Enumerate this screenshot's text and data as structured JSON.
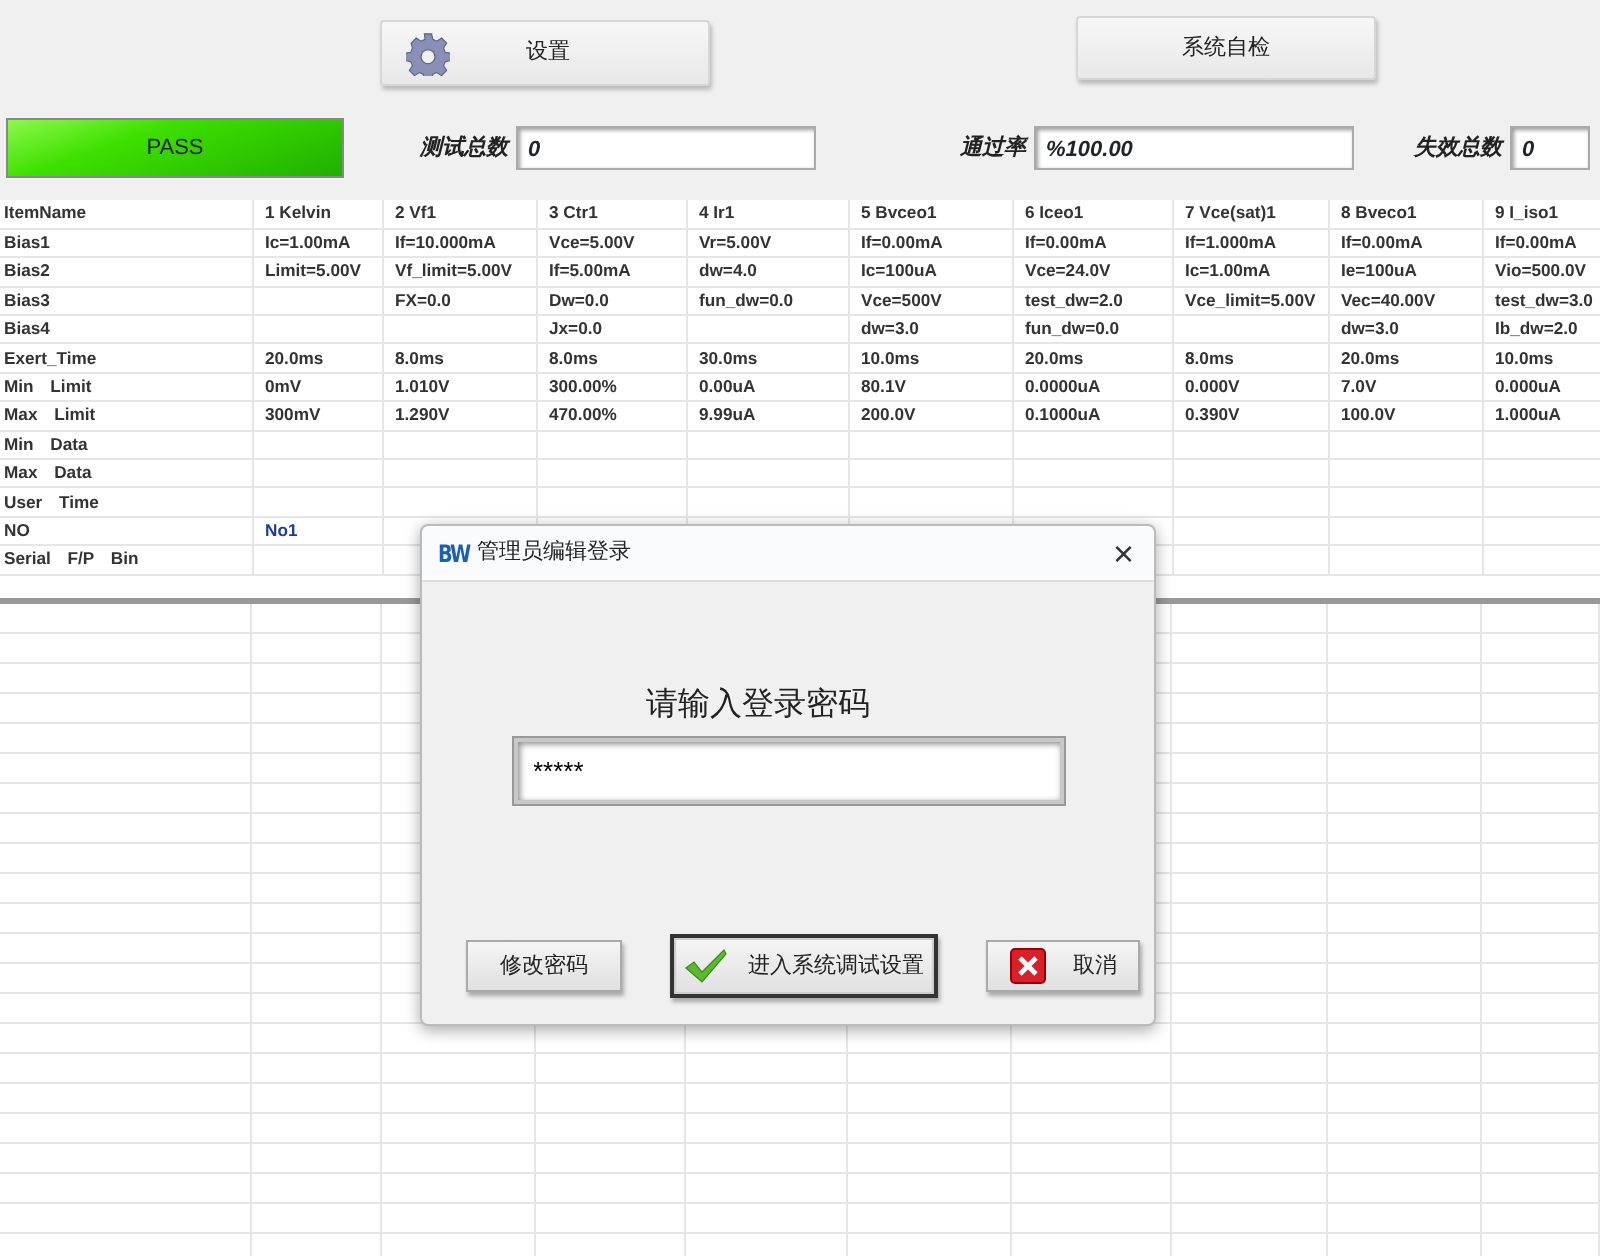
{
  "toolbar": {
    "buttons": [
      {
        "label": "设置",
        "kind": "gear"
      },
      {
        "label": "系统自检",
        "kind": "plain"
      }
    ]
  },
  "status": {
    "result": "PASS",
    "kind": "pass"
  },
  "counters": [
    {
      "label": "测试总数",
      "value": "0"
    },
    {
      "label": "通过率",
      "value": "%100.00"
    },
    {
      "label": "失效总数",
      "value": "0"
    }
  ],
  "table": {
    "corner": "ItemName",
    "columns": [
      "1 Kelvin",
      "2 Vf1",
      "3 Ctr1",
      "4 Ir1",
      "5 Bvceo1",
      "6 Iceo1",
      "7 Vce(sat)1",
      "8 Bveco1",
      "9 I_iso1"
    ],
    "rows": [
      {
        "label": "Bias1",
        "kind": "data",
        "cells": [
          "Ic=1.00mA",
          "If=10.000mA",
          "Vce=5.00V",
          "Vr=5.00V",
          "If=0.00mA",
          "If=0.00mA",
          "If=1.000mA",
          "If=0.00mA",
          "If=0.00mA"
        ]
      },
      {
        "label": "Bias2",
        "kind": "data",
        "cells": [
          "Limit=5.00V",
          "Vf_limit=5.00V",
          "If=5.00mA",
          "dw=4.0",
          "Ic=100uA",
          "Vce=24.0V",
          "Ic=1.00mA",
          "Ie=100uA",
          "Vio=500.0V"
        ]
      },
      {
        "label": "Bias3",
        "kind": "data",
        "cells": [
          null,
          "FX=0.0",
          "Dw=0.0",
          "fun_dw=0.0",
          "Vce=500V",
          "test_dw=2.0",
          "Vce_limit=5.00V",
          "Vec=40.00V",
          "test_dw=3.0"
        ]
      },
      {
        "label": "Bias4",
        "kind": "data",
        "cells": [
          null,
          null,
          "Jx=0.0",
          null,
          "dw=3.0",
          "fun_dw=0.0",
          null,
          "dw=3.0",
          "Ib_dw=2.0"
        ]
      },
      {
        "label": "Exert_Time",
        "kind": "data",
        "cells": [
          "20.0ms",
          "8.0ms",
          "8.0ms",
          "30.0ms",
          "10.0ms",
          "20.0ms",
          "8.0ms",
          "20.0ms",
          "10.0ms"
        ]
      },
      {
        "label": "Min Limit",
        "kind": "data",
        "cells": [
          "0mV",
          "1.010V",
          "300.00%",
          "0.00uA",
          "80.1V",
          "0.0000uA",
          "0.000V",
          "7.0V",
          "0.000uA"
        ]
      },
      {
        "label": "Max Limit",
        "kind": "data",
        "cells": [
          "300mV",
          "1.290V",
          "470.00%",
          "9.99uA",
          "200.0V",
          "0.1000uA",
          "0.390V",
          "100.0V",
          "1.000uA"
        ]
      },
      {
        "label": "Min Data",
        "kind": "data"
      },
      {
        "label": "Max Data",
        "kind": "data"
      },
      {
        "label": "User Time",
        "kind": "data"
      },
      {
        "label": "NO",
        "kind": "id",
        "cells": [
          "No1"
        ]
      },
      {
        "label": "Serial F/P Bin",
        "kind": "data"
      }
    ]
  },
  "dialog": {
    "logo": "BW",
    "title": "管理员编辑登录",
    "close": "×",
    "prompt": "请输入登录密码",
    "password": "*****",
    "buttons": [
      {
        "label": "修改密码",
        "kind": "plain",
        "default": false
      },
      {
        "label": "进入系统调试设置",
        "kind": "ok",
        "default": true
      },
      {
        "label": "取消",
        "kind": "cancel",
        "default": false
      }
    ]
  }
}
